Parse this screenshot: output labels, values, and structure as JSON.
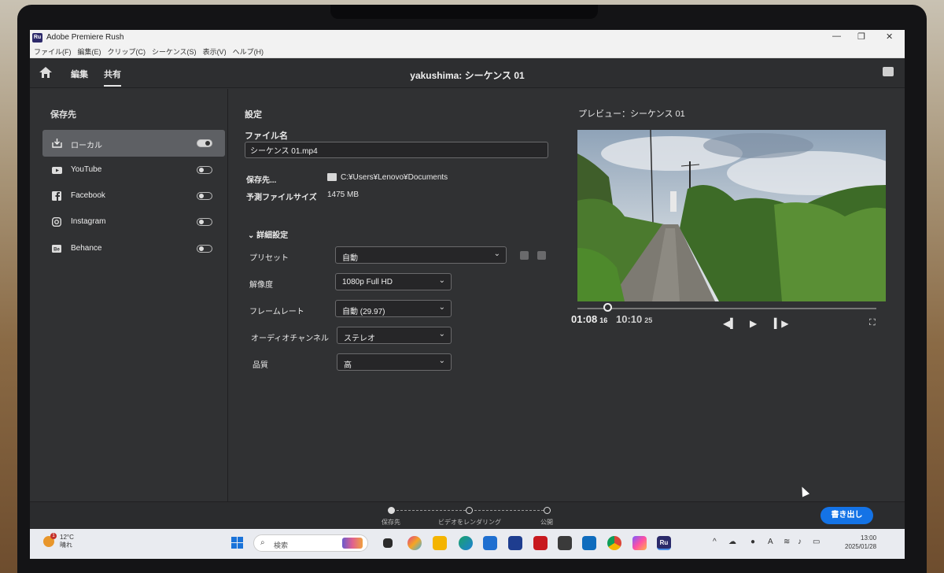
{
  "window": {
    "title": "Adobe Premiere Rush",
    "logo": "Ru",
    "minimize": "—",
    "maximize": "❐",
    "close": "✕"
  },
  "menu": [
    "ファイル(F)",
    "編集(E)",
    "クリップ(C)",
    "シーケンス(S)",
    "表示(V)",
    "ヘルプ(H)"
  ],
  "header": {
    "tabs": [
      "編集",
      "共有"
    ],
    "active_tab": "共有",
    "sequence_title": "yakushima: シーケンス 01"
  },
  "left": {
    "heading": "保存先",
    "destinations": [
      {
        "label": "ローカル",
        "icon": "download-icon",
        "enabled": true
      },
      {
        "label": "YouTube",
        "icon": "youtube-icon",
        "enabled": false
      },
      {
        "label": "Facebook",
        "icon": "facebook-icon",
        "enabled": false
      },
      {
        "label": "Instagram",
        "icon": "instagram-icon",
        "enabled": false
      },
      {
        "label": "Behance",
        "icon": "behance-icon",
        "enabled": false
      }
    ]
  },
  "settings": {
    "heading": "設定",
    "filename_label": "ファイル名",
    "filename_value": "シーケンス 01.mp4",
    "save_to_label": "保存先...",
    "save_to_path": "C:¥Users¥Lenovo¥Documents",
    "size_label": "予測ファイルサイズ",
    "size_value": "1475 MB",
    "advanced_label": "詳細設定",
    "preset_label": "プリセット",
    "preset_value": "自動",
    "resolution_label": "解像度",
    "resolution_value": "1080p Full HD",
    "framerate_label": "フレームレート",
    "framerate_value": "自動 (29.97)",
    "audio_label": "オーディオチャンネル",
    "audio_value": "ステレオ",
    "quality_label": "品質",
    "quality_value": "高"
  },
  "preview": {
    "title": "プレビュー：シーケンス 01",
    "current_time": "01:08",
    "current_frames": "16",
    "total_time": "10:10",
    "total_frames": "25",
    "scrub_position": 0.1
  },
  "steps": {
    "items": [
      "保存先",
      "ビデオをレンダリング",
      "公開"
    ],
    "current": 0
  },
  "export_button": "書き出し",
  "taskbar": {
    "weather_badge": "1",
    "temperature": "12°C",
    "weather_text": "晴れ",
    "search_placeholder": "検索",
    "time": "13:00",
    "date": "2025/01/28",
    "ime": "A"
  },
  "colors": {
    "accent": "#1473e6",
    "panel_bg": "#303133",
    "header_bg": "#2d2e30"
  }
}
